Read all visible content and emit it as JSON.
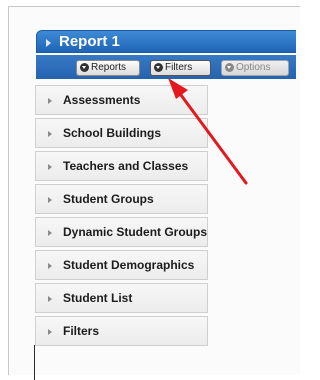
{
  "report": {
    "title": "Report 1"
  },
  "toolbar": {
    "reports_label": "Reports",
    "filters_label": "Filters",
    "options_label": "Options"
  },
  "menu": {
    "items": [
      {
        "label": "Assessments"
      },
      {
        "label": "School Buildings"
      },
      {
        "label": "Teachers and Classes"
      },
      {
        "label": "Student Groups"
      },
      {
        "label": "Dynamic Student Groups"
      },
      {
        "label": "Student Demographics"
      },
      {
        "label": "Student List"
      },
      {
        "label": "Filters"
      }
    ]
  },
  "colors": {
    "titlebar": "#2b74c8",
    "annotation_arrow": "#e3191f"
  }
}
